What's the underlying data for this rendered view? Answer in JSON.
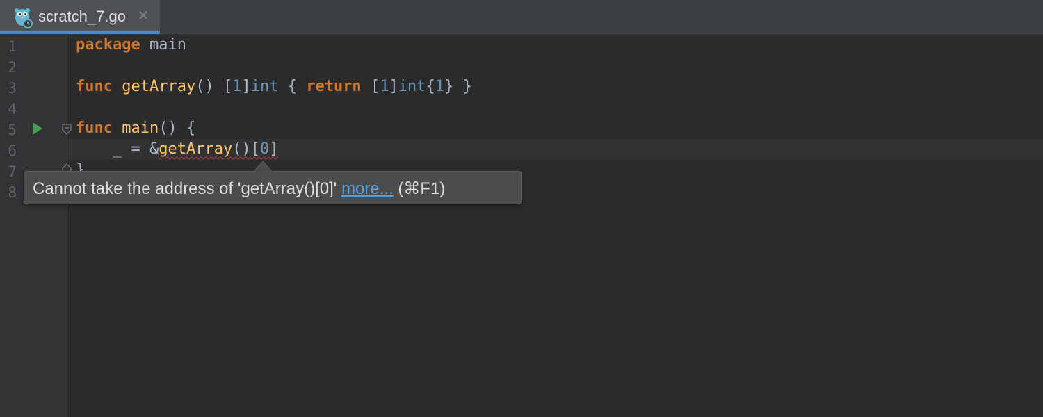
{
  "tab": {
    "filename": "scratch_7.go",
    "icon": "gopher-scratch-icon",
    "close_glyph": "✕"
  },
  "gutter": {
    "line_numbers": [
      "1",
      "2",
      "3",
      "4",
      "5",
      "6",
      "7",
      "8"
    ]
  },
  "code": {
    "line1": {
      "keyword": "package",
      "name": "main"
    },
    "line3": {
      "kw_func": "func",
      "fn_name": "getArray",
      "parens": "()",
      "open_bracket": "[",
      "len": "1",
      "close_bracket": "]",
      "type": "int",
      "brace_open": "{",
      "kw_return": "return",
      "ret_open_bracket": "[",
      "ret_len": "1",
      "ret_close_bracket": "]",
      "ret_type": "int",
      "lit_open": "{",
      "lit_val": "1",
      "lit_close": "}",
      "brace_close": "}"
    },
    "line5": {
      "kw_func": "func",
      "fn_name": "main",
      "parens": "()",
      "brace_open": "{"
    },
    "line6": {
      "indent": "    ",
      "blank": "_",
      "assign": " = ",
      "amp": "&",
      "call": "getArray",
      "call_parens": "()",
      "idx_open": "[",
      "idx": "0",
      "idx_close": "]"
    },
    "line7": {
      "brace_close": "}"
    }
  },
  "tooltip": {
    "message": "Cannot take the address of 'getArray()[0]' ",
    "link_text": "more...",
    "shortcut": " (⌘F1)"
  },
  "colors": {
    "background": "#2b2b2b",
    "keyword": "#cc7832",
    "function": "#ffc66d",
    "number": "#6897bb",
    "text": "#a9b7c6",
    "error_underline": "#bc3f3c",
    "tab_accent": "#4a88c7",
    "run_icon": "#499c54"
  }
}
